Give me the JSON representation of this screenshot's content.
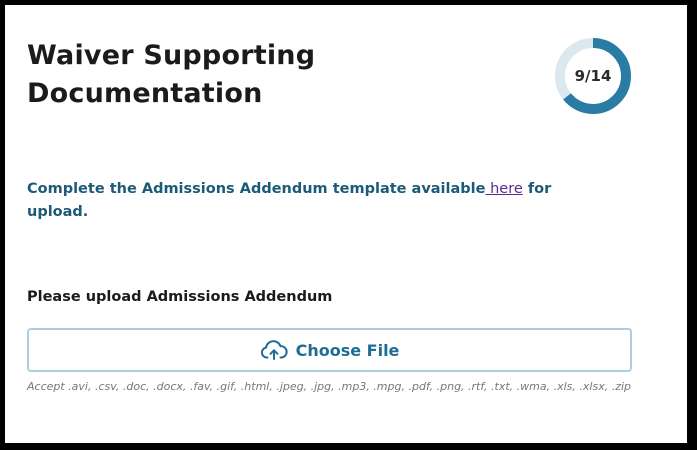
{
  "card": {
    "title": "Waiver Supporting Documentation",
    "progress": {
      "label": "9/14",
      "completed": 9,
      "total": 14,
      "color": "#2a7ca5",
      "track_color": "#dbe8ef"
    }
  },
  "instructions": {
    "text_before": "Complete the Admissions Addendum template available",
    "link_text": " here",
    "text_after": " for upload."
  },
  "upload": {
    "label": "Please upload Admissions Addendum",
    "button_label": "Choose File",
    "button_icon": "cloud-upload-icon",
    "accept_text": "Accept .avi, .csv, .doc, .docx, .fav, .gif, .html, .jpeg, .jpg, .mp3, .mpg, .pdf, .png, .rtf, .txt, .wma, .xls, .xlsx, .zip"
  }
}
